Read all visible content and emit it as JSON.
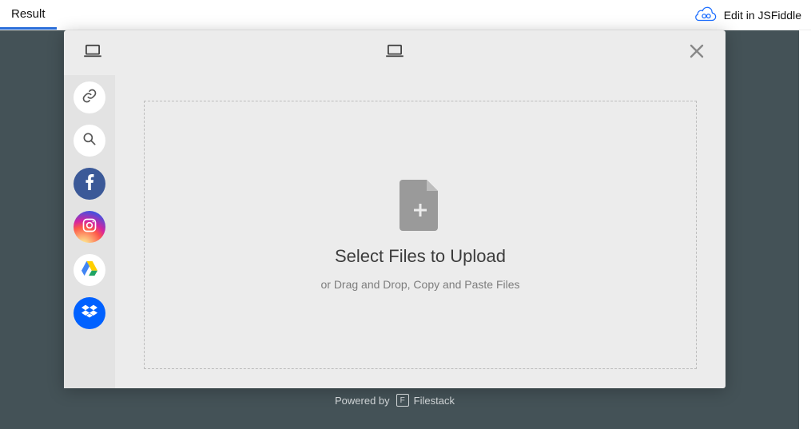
{
  "tabs": {
    "result": "Result"
  },
  "edit_link": "Edit in JSFiddle",
  "picker": {
    "title": "Select Files to Upload",
    "subtitle": "or Drag and Drop, Copy and Paste Files"
  },
  "sources": {
    "link": "link-source",
    "search": "web-search-source",
    "facebook": "facebook-source",
    "instagram": "instagram-source",
    "googledrive": "google-drive-source",
    "dropbox": "dropbox-source"
  },
  "footer": {
    "powered_by": "Powered by",
    "brand": "Filestack"
  }
}
